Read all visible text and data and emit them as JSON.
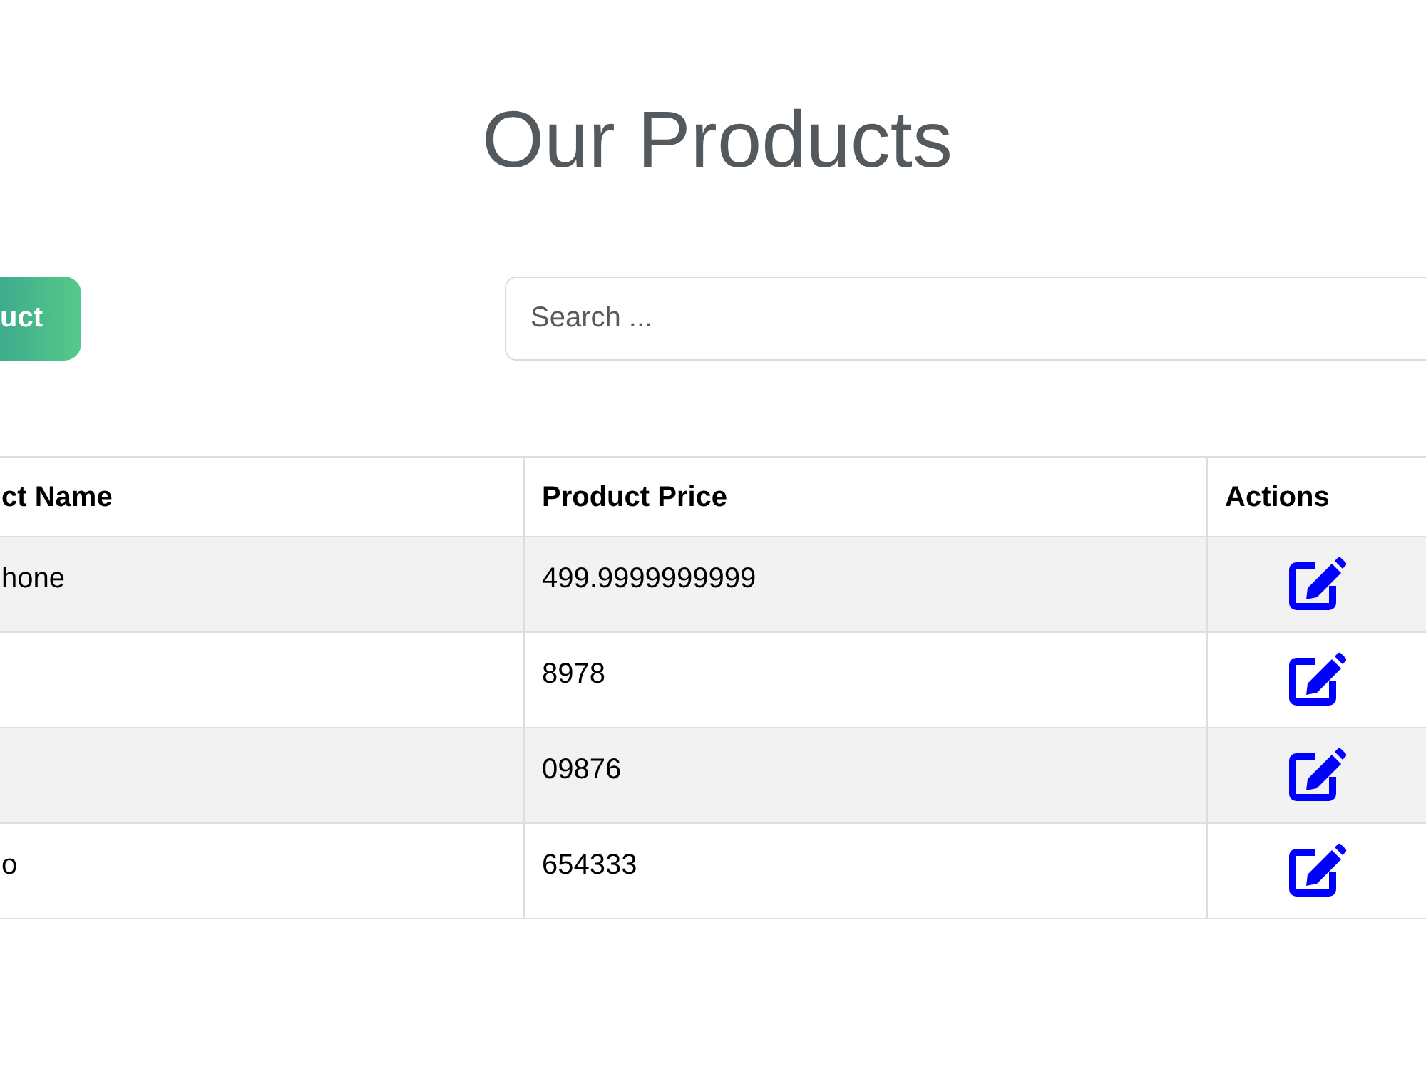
{
  "page": {
    "title": "Our Products"
  },
  "toolbar": {
    "button": "uct",
    "search": {
      "placeholder": "Search ..."
    }
  },
  "table": {
    "columns": [
      "ct Name",
      "Product Price",
      "Actions"
    ],
    "rows": [
      {
        "name": "hone",
        "price": "499.9999999999"
      },
      {
        "price": "8978"
      },
      {
        "price": "09876"
      },
      {
        "name": "o",
        "price": "654333"
      }
    ]
  }
}
